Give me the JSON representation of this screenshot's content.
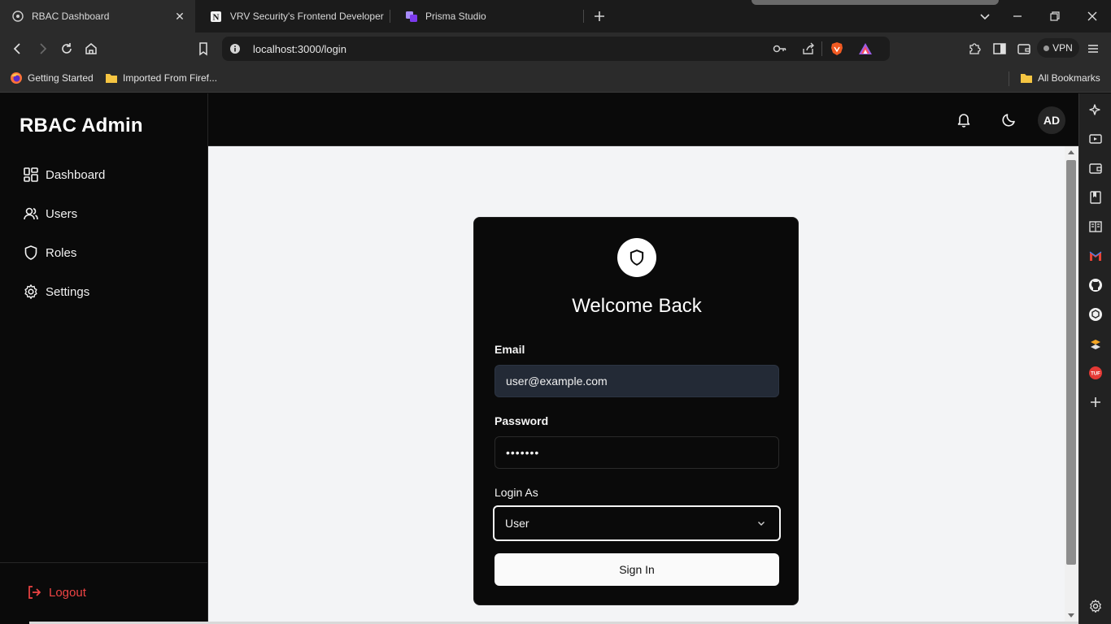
{
  "browser": {
    "tabs": [
      {
        "title": "RBAC Dashboard",
        "icon": "globe-icon",
        "active": true
      },
      {
        "title": "VRV Security's Frontend Developer I",
        "icon": "notion-icon",
        "active": false
      },
      {
        "title": "Prisma Studio",
        "icon": "prisma-icon",
        "active": false
      }
    ],
    "url": "localhost:3000/login",
    "vpn_label": "VPN",
    "bookmarks": [
      {
        "label": "Getting Started",
        "icon": "firefox-icon"
      },
      {
        "label": "Imported From Firef...",
        "icon": "folder-icon"
      }
    ],
    "all_bookmarks_label": "All Bookmarks"
  },
  "app": {
    "brand": "RBAC Admin",
    "nav": [
      {
        "label": "Dashboard",
        "icon": "dashboard-icon"
      },
      {
        "label": "Users",
        "icon": "users-icon"
      },
      {
        "label": "Roles",
        "icon": "shield-icon"
      },
      {
        "label": "Settings",
        "icon": "gear-icon"
      }
    ],
    "logout_label": "Logout",
    "avatar_initials": "AD"
  },
  "login": {
    "title": "Welcome Back",
    "email_label": "Email",
    "email_value": "user@example.com",
    "password_label": "Password",
    "password_value": "•••••••",
    "role_label": "Login As",
    "role_value": "User",
    "submit_label": "Sign In"
  },
  "colors": {
    "accent_danger": "#ef4444",
    "sidebar_bg": "#0a0a0a",
    "main_bg": "#f3f4f6",
    "input_filled_bg": "#232a36"
  }
}
